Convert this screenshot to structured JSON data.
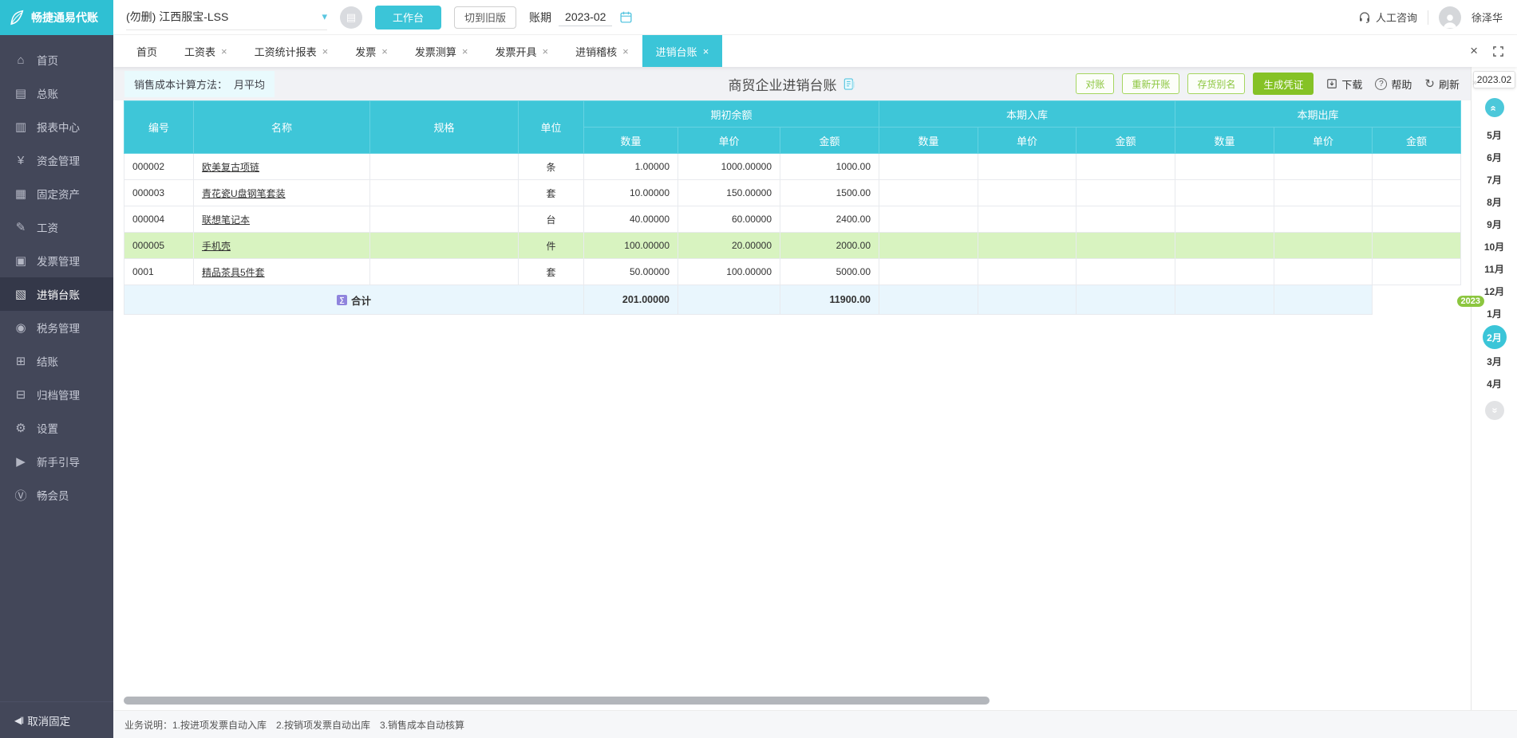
{
  "logo": {
    "text": "畅捷通易代账"
  },
  "colors": {
    "accent": "#3bc5d8",
    "green": "#8cc63f",
    "primary_green": "#85c226",
    "sidebar_bg": "#434759",
    "highlight_row": "#d8f3c0",
    "header_cyan": "#3ec6d8"
  },
  "icons": {
    "close": "×",
    "chevron_down": "▾",
    "refresh": "↻",
    "question": "?",
    "unpin": "◀‖",
    "sum": "∑",
    "note": "▤",
    "chevrons": "«",
    "panel_collapse": "»"
  },
  "topbar": {
    "company": "(勿删) 江西服宝-LSS",
    "workbench_btn": "工作台",
    "switch_old_btn": "切到旧版",
    "period_label": "账期",
    "period_value": "2023-02",
    "support": "人工咨询",
    "username": "徐泽华"
  },
  "tabs": {
    "items": [
      {
        "label": "首页"
      },
      {
        "label": "工资表"
      },
      {
        "label": "工资统计报表"
      },
      {
        "label": "发票"
      },
      {
        "label": "发票测算"
      },
      {
        "label": "发票开具"
      },
      {
        "label": "进销稽核"
      },
      {
        "label": "进销台账"
      }
    ],
    "active": "进销台账"
  },
  "toolbar": {
    "cost_method_label": "销售成本计算方法：",
    "cost_method_value": "月平均",
    "title": "商贸企业进销台账",
    "actions": [
      "对账",
      "重新开账",
      "存货别名"
    ],
    "primary_action": "生成凭证",
    "download_label": "下载",
    "help_label": "帮助",
    "refresh_label": "刷新"
  },
  "table": {
    "base_columns": [
      "编号",
      "名称",
      "规格",
      "单位"
    ],
    "groups": [
      {
        "label": "期初余额"
      },
      {
        "label": "本期入库"
      },
      {
        "label": "本期出库"
      }
    ],
    "sub_columns": [
      "数量",
      "单价",
      "金额"
    ],
    "rows": [
      {
        "code": "000002",
        "name": "欧美复古项链",
        "spec": "",
        "unit": "条",
        "opening_qty": "1.00000",
        "opening_price": "1000.00000",
        "opening_amount": "1000.00"
      },
      {
        "code": "000003",
        "name": "青花瓷U盘钢笔套装",
        "spec": "",
        "unit": "套",
        "opening_qty": "10.00000",
        "opening_price": "150.00000",
        "opening_amount": "1500.00"
      },
      {
        "code": "000004",
        "name": "联想笔记本",
        "spec": "",
        "unit": "台",
        "opening_qty": "40.00000",
        "opening_price": "60.00000",
        "opening_amount": "2400.00"
      },
      {
        "code": "000005",
        "name": "手机壳",
        "spec": "",
        "unit": "件",
        "opening_qty": "100.00000",
        "opening_price": "20.00000",
        "opening_amount": "2000.00"
      },
      {
        "code": "0001",
        "name": "精品茶具5件套",
        "spec": "",
        "unit": "套",
        "opening_qty": "50.00000",
        "opening_price": "100.00000",
        "opening_amount": "5000.00"
      }
    ],
    "total": {
      "label": "合计",
      "opening_qty": "201.00000",
      "opening_amount": "11900.00"
    }
  },
  "months": {
    "current": "2023.02",
    "year_badge": "2023",
    "items": [
      "5月",
      "6月",
      "7月",
      "8月",
      "9月",
      "10月",
      "11月",
      "12月",
      "1月",
      "2月",
      "3月",
      "4月"
    ],
    "active": "2月"
  },
  "sidebar": {
    "items": [
      {
        "label": "首页",
        "glyph": "⌂"
      },
      {
        "label": "总账",
        "glyph": "▤"
      },
      {
        "label": "报表中心",
        "glyph": "▥"
      },
      {
        "label": "资金管理",
        "glyph": "¥"
      },
      {
        "label": "固定资产",
        "glyph": "▦"
      },
      {
        "label": "工资",
        "glyph": "✎"
      },
      {
        "label": "发票管理",
        "glyph": "▣"
      },
      {
        "label": "进销台账",
        "glyph": "▧"
      },
      {
        "label": "税务管理",
        "glyph": "◉"
      },
      {
        "label": "结账",
        "glyph": "⊞"
      },
      {
        "label": "归档管理",
        "glyph": "⊟"
      },
      {
        "label": "设置",
        "glyph": "⚙"
      },
      {
        "label": "新手引导",
        "glyph": "▶"
      },
      {
        "label": "畅会员",
        "glyph": "Ⓥ"
      }
    ],
    "active": "进销台账",
    "unpin": "取消固定"
  },
  "footer": {
    "note": "业务说明：1.按进项发票自动入库　2.按销项发票自动出库　3.销售成本自动核算"
  }
}
